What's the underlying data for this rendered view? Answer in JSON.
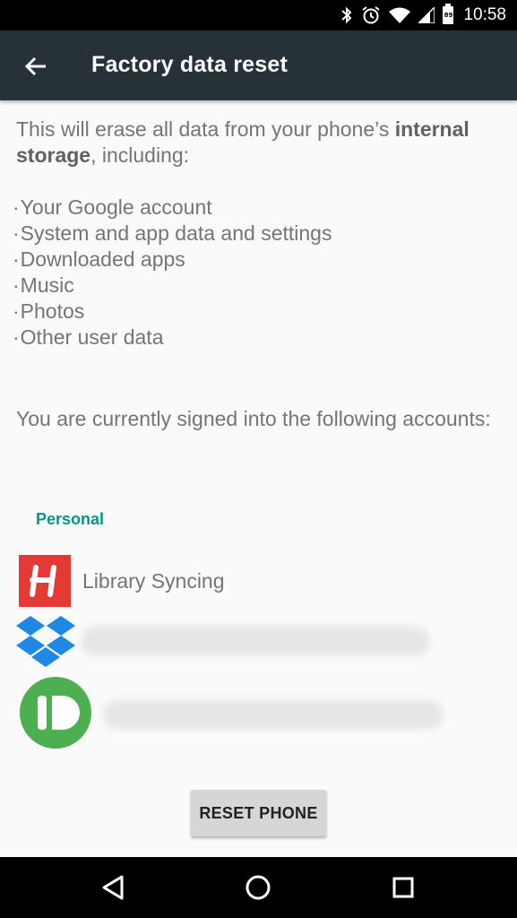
{
  "status_bar": {
    "time": "10:58",
    "battery_level": "89",
    "icons": [
      "bluetooth-icon",
      "alarm-icon",
      "wifi-icon",
      "cell-signal-icon",
      "battery-icon"
    ]
  },
  "app_bar": {
    "title": "Factory data reset",
    "back_icon": "arrow-back-icon",
    "color": "#263238"
  },
  "intro": {
    "text_before": "This will erase all data from your phone’s ",
    "bold": "internal storage",
    "text_after": ", including:"
  },
  "erase_items": [
    "Your Google account",
    "System and app data and settings",
    "Downloaded apps",
    "Music",
    "Photos",
    "Other user data"
  ],
  "signed_in_text": "You are currently signed into the following accounts:",
  "accounts": {
    "section_label": "Personal",
    "section_color": "#009688",
    "items": [
      {
        "icon": "hundred-zeros-app-icon",
        "label": "Library Syncing"
      },
      {
        "icon": "dropbox-icon",
        "label": ""
      },
      {
        "icon": "pushbullet-icon",
        "label": ""
      }
    ]
  },
  "reset_button": {
    "label": "RESET PHONE"
  },
  "nav_bar": {
    "icons": [
      "back-triangle-icon",
      "home-circle-icon",
      "recents-square-icon"
    ]
  }
}
